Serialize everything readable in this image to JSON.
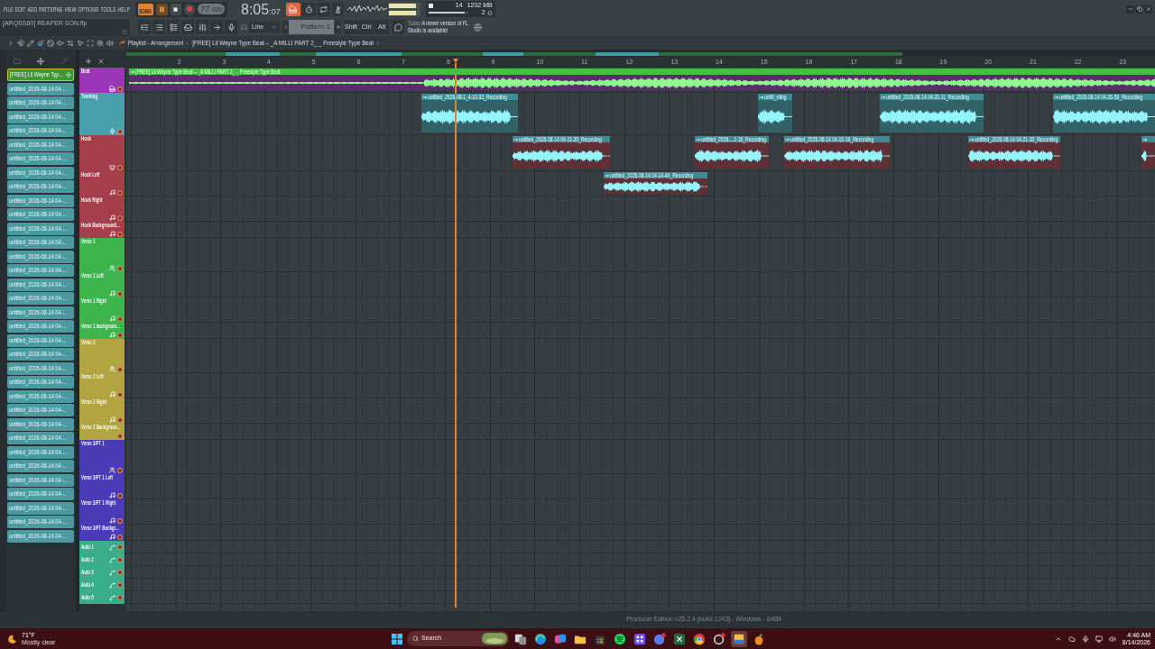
{
  "menu": [
    "FILE",
    "EDIT",
    "ADD",
    "PATTERNS",
    "VIEW",
    "OPTIONS",
    "TOOLS",
    "HELP"
  ],
  "transport": {
    "mode": "SONG",
    "playing": true,
    "tempo": "77",
    "tempo_fraction": "000",
    "time": "8:05",
    "time_fraction": ":07",
    "typing_keyboard": true
  },
  "meters": {
    "output": [
      {
        "level": 0.9
      },
      {
        "level": 0.9
      }
    ],
    "cpu": "14",
    "memory": "1202 MB",
    "polyphony": "2",
    "cpu_meter": {
      "level": 0.92
    }
  },
  "hint": "[ARQSS60] REAPER SON.flp",
  "toolbar": {
    "audio_input": "Line",
    "pattern": "Pattern 1",
    "modifier_keys": [
      "Shift",
      "Ctrl",
      "Alt"
    ]
  },
  "news": {
    "date": "Today",
    "message": "A newer version of FL Studio is available!"
  },
  "playlist": {
    "tools": [
      {
        "kind": "menu",
        "selected": false
      },
      {
        "kind": "snap",
        "selected": false
      },
      {
        "kind": "draw",
        "selected": false
      },
      {
        "kind": "paint",
        "selected": true
      },
      {
        "kind": "delete",
        "selected": false
      },
      {
        "kind": "mute",
        "selected": false
      },
      {
        "kind": "slip",
        "selected": false
      },
      {
        "kind": "select",
        "selected": false
      },
      {
        "kind": "region",
        "selected": false
      },
      {
        "kind": "zoom",
        "selected": false
      },
      {
        "kind": "playback",
        "selected": false
      }
    ],
    "breadcrumb": [
      "Playlist - Arrangement",
      "[FREE] Lil Wayne Type Beat – _A MILLI PART 2_ _ Freestyle Type Beat"
    ],
    "ruler": [
      "2",
      "3",
      "4",
      "5",
      "6",
      "7",
      "8",
      "9",
      "10",
      "11",
      "12",
      "13",
      "14",
      "15",
      "16",
      "17",
      "18",
      "19",
      "20",
      "21",
      "22",
      "23"
    ],
    "tracks": [
      {
        "name": "Beat",
        "color": "#9b36b6",
        "kind": "piano",
        "clips": [
          {
            "name": "[FREE] Lil Wayne Type Beat – _A MILLI PART 2_ _ Freestyle Type Beat",
            "color": "#45c045",
            "kind": "audio"
          }
        ]
      },
      {
        "name": "Tracking",
        "color": "#47a0aa",
        "kind": "mic",
        "clips": [
          {
            "name": "untitled_2026-08-1_4-10-32_Recording",
            "color": "#3d8d95",
            "kind": "audio"
          },
          {
            "name": "untitl_rding",
            "color": "#3d8d95",
            "kind": "audio"
          },
          {
            "name": "untitled_2026-08-14 04-20-11_Recording",
            "color": "#3d8d95",
            "kind": "audio"
          },
          {
            "name": "untitled_2026-08-14 04-26-56_Recording",
            "color": "#3d8d95",
            "kind": "audio"
          }
        ]
      },
      {
        "name": "Hook",
        "color": "#a43e4a",
        "kind": "crown",
        "clips": [
          {
            "name": "untitled_2026-08-14 04-11-20_Recording",
            "color": "#3d8d95",
            "kind": "audio"
          },
          {
            "name": "untitled_2026-...2-18_Recording",
            "color": "#3d8d95",
            "kind": "audio"
          },
          {
            "name": "untitled_2026-08-14 04-19-16_Recording",
            "color": "#3d8d95",
            "kind": "audio"
          },
          {
            "name": "untitled_2026-08-14 04-21-30_Recording",
            "color": "#3d8d95",
            "kind": "audio"
          },
          {
            "color": "#3d8d95",
            "kind": "audio"
          }
        ]
      },
      {
        "name": "Hook Left",
        "color": "#a43e4a",
        "kind": "note",
        "clips": [
          {
            "name": "untitled_2026-08-14 04-14-49_Recording",
            "color": "#3d8d95",
            "kind": "audio"
          }
        ]
      },
      {
        "name": "Hook Right",
        "color": "#a43e4a",
        "kind": "note"
      },
      {
        "name": "Hook Background/...",
        "color": "#a43e4a",
        "kind": "short"
      },
      {
        "name": "Verse 1",
        "color": "#3db54c",
        "kind": "people"
      },
      {
        "name": "Verse 1 Left",
        "color": "#3db54c",
        "kind": "note"
      },
      {
        "name": "Verse 1 Right",
        "color": "#3db54c",
        "kind": "note"
      },
      {
        "name": "Verse 1 backgroun...",
        "color": "#3db54c",
        "kind": "short"
      },
      {
        "name": "Verse 2",
        "color": "#b2a541",
        "kind": "people"
      },
      {
        "name": "Verse 2 Left",
        "color": "#b2a541",
        "kind": "note"
      },
      {
        "name": "Verse 2 Right",
        "color": "#b2a541",
        "kind": "note"
      },
      {
        "name": "Verse 2 Backgroun...",
        "color": "#b2a541",
        "kind": "bare"
      },
      {
        "name": "Verse 3/FT 1",
        "color": "#4b3bb6",
        "kind": "people"
      },
      {
        "name": "Verse 3/FT 1 Left",
        "color": "#4b3bb6",
        "kind": "note"
      },
      {
        "name": "Verse 3/FT 1 Right",
        "color": "#4b3bb6",
        "kind": "note"
      },
      {
        "name": "Verse 3/FT Backgr...",
        "color": "#4b3bb6",
        "kind": "short"
      },
      {
        "name": "Auto 1",
        "color": "#3aae8b",
        "kind": "auto"
      },
      {
        "name": "Auto 2",
        "color": "#3aae8b",
        "kind": "auto"
      },
      {
        "name": "Auto 3",
        "color": "#3aae8b",
        "kind": "auto"
      },
      {
        "name": "Auto 4",
        "color": "#3aae8b",
        "kind": "auto"
      },
      {
        "name": "Auto 5",
        "color": "#3aae8b",
        "kind": "auto"
      }
    ]
  },
  "browser": {
    "clips": [
      {
        "name": "[FREE] Lil Wayne Typ...",
        "selected": true
      },
      {
        "name": "untitled_2026-08-14 04-...",
        "selected": false
      },
      {
        "name": "untitled_2026-08-14 04-...",
        "selected": false
      },
      {
        "name": "untitled_2026-08-14 04-...",
        "selected": false
      },
      {
        "name": "untitled_2026-08-14 04-...",
        "selected": false
      },
      {
        "name": "untitled_2026-08-14 04-...",
        "selected": false
      },
      {
        "name": "untitled_2026-08-14 04-...",
        "selected": false
      },
      {
        "name": "untitled_2026-08-14 04-...",
        "selected": false
      },
      {
        "name": "untitled_2026-08-14 04-...",
        "selected": false
      },
      {
        "name": "untitled_2026-08-14 04-...",
        "selected": false
      },
      {
        "name": "untitled_2026-08-14 04-...",
        "selected": false
      },
      {
        "name": "untitled_2026-08-14 04-...",
        "selected": false
      },
      {
        "name": "untitled_2026-08-14 04-...",
        "selected": false
      },
      {
        "name": "untitled_2026-08-14 04-...",
        "selected": false
      },
      {
        "name": "untitled_2026-08-14 04-...",
        "selected": false
      },
      {
        "name": "untitled_2026-08-14 04-...",
        "selected": false
      },
      {
        "name": "untitled_2026-08-14 04-...",
        "selected": false
      },
      {
        "name": "untitled_2026-08-14 04-...",
        "selected": false
      },
      {
        "name": "untitled_2026-08-14 04-...",
        "selected": false
      },
      {
        "name": "untitled_2026-08-14 04-...",
        "selected": false
      },
      {
        "name": "untitled_2026-08-14 04-...",
        "selected": false
      },
      {
        "name": "untitled_2026-08-14 04-...",
        "selected": false
      },
      {
        "name": "untitled_2026-08-14 04-...",
        "selected": false
      },
      {
        "name": "untitled_2026-08-14 04-...",
        "selected": false
      },
      {
        "name": "untitled_2026-08-14 04-...",
        "selected": false
      },
      {
        "name": "untitled_2026-08-14 04-...",
        "selected": false
      },
      {
        "name": "untitled_2026-08-14 04-...",
        "selected": false
      },
      {
        "name": "untitled_2026-08-14 04-...",
        "selected": false
      },
      {
        "name": "untitled_2026-08-14 04-...",
        "selected": false
      },
      {
        "name": "untitled_2026-08-14 04-...",
        "selected": false
      },
      {
        "name": "untitled_2026-08-14 04-...",
        "selected": false
      },
      {
        "name": "untitled_2026-08-14 04-...",
        "selected": false
      },
      {
        "name": "untitled_2026-08-14 04-...",
        "selected": false
      },
      {
        "name": "untitled_2026-08-14 04-...",
        "selected": false
      }
    ]
  },
  "status_bar": "Producer Edition v25.2.4 [build 1243] - Windows - 64Bit",
  "taskbar": {
    "weather": {
      "temperature": "71°F",
      "condition": "Mostly clear"
    },
    "search": {
      "placeholder": "Search"
    },
    "clock": {
      "time": "4:46 AM",
      "date": "8/14/2026"
    }
  }
}
